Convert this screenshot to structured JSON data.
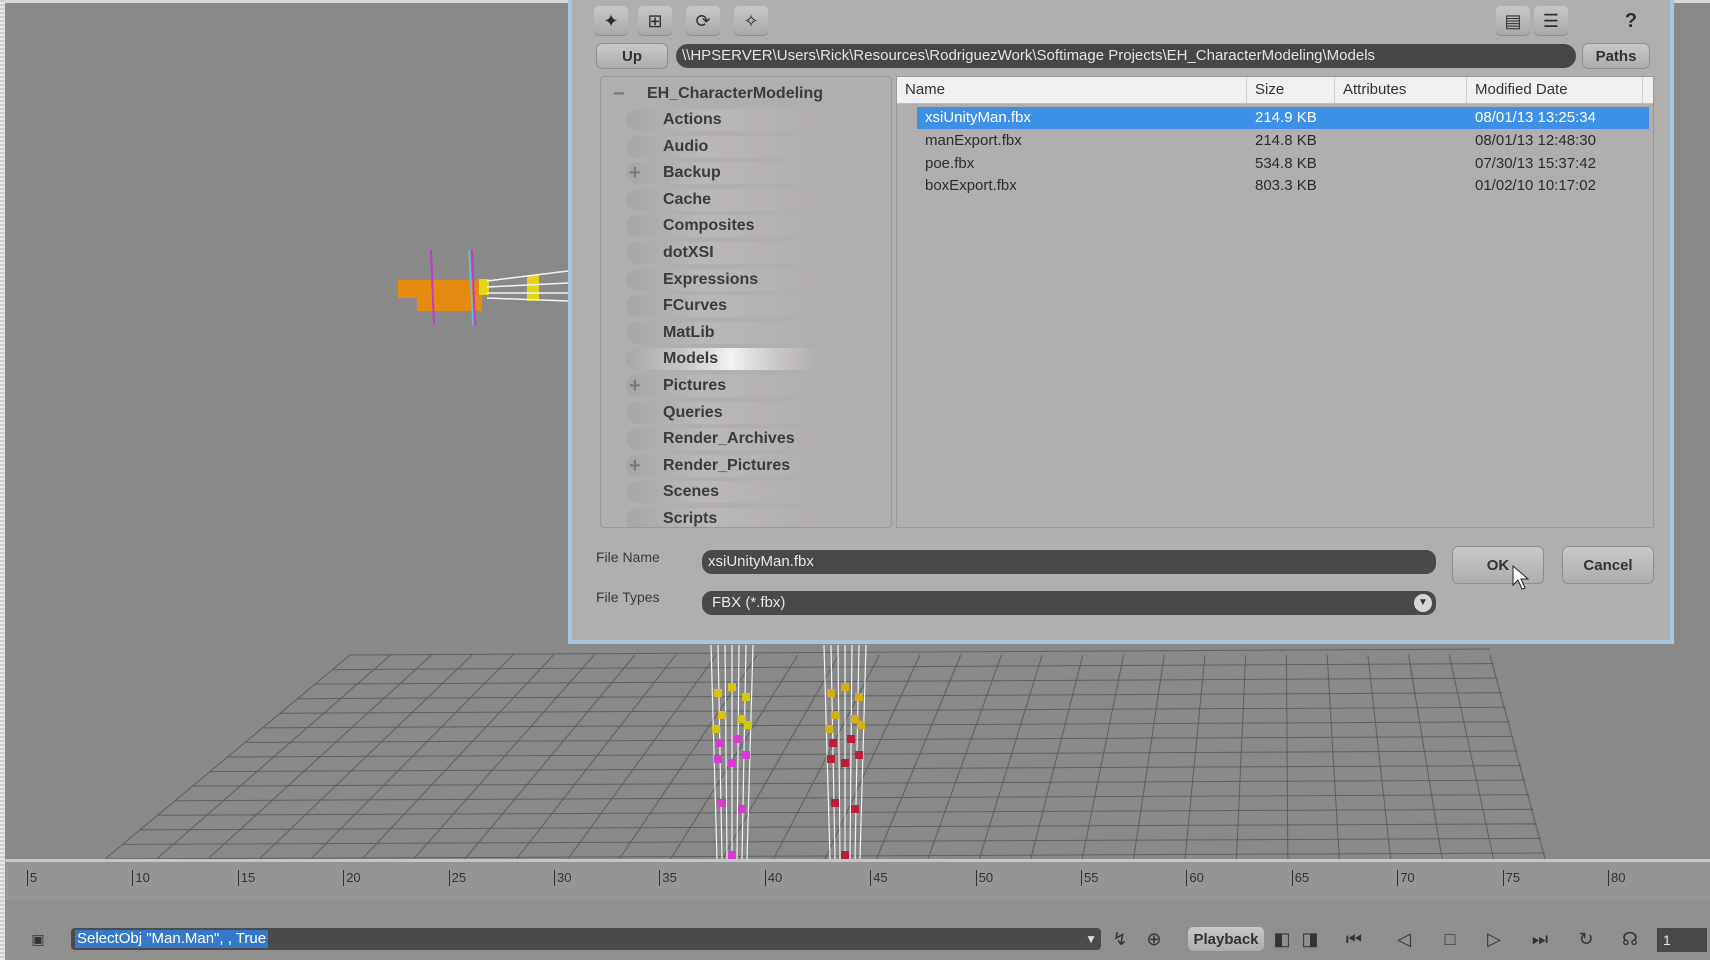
{
  "dialog": {
    "toolbar_icons": [
      "new-folder-icon",
      "network-icon",
      "refresh-icon",
      "open-folder-icon"
    ],
    "right_icons": [
      "clapper-icon",
      "list-view-icon",
      "help-icon"
    ],
    "up_label": "Up",
    "path": "\\\\HPSERVER\\Users\\Rick\\Resources\\RodriguezWork\\Softimage Projects\\EH_CharacterModeling\\Models",
    "paths_label": "Paths",
    "help_glyph": "?",
    "tree": {
      "root": {
        "label": "EH_CharacterModeling",
        "expander": "−"
      },
      "items": [
        {
          "label": "Actions",
          "expander": ""
        },
        {
          "label": "Audio",
          "expander": ""
        },
        {
          "label": "Backup",
          "expander": "+"
        },
        {
          "label": "Cache",
          "expander": ""
        },
        {
          "label": "Composites",
          "expander": ""
        },
        {
          "label": "dotXSI",
          "expander": ""
        },
        {
          "label": "Expressions",
          "expander": ""
        },
        {
          "label": "FCurves",
          "expander": ""
        },
        {
          "label": "MatLib",
          "expander": ""
        },
        {
          "label": "Models",
          "expander": "",
          "selected": true
        },
        {
          "label": "Pictures",
          "expander": "+"
        },
        {
          "label": "Queries",
          "expander": ""
        },
        {
          "label": "Render_Archives",
          "expander": ""
        },
        {
          "label": "Render_Pictures",
          "expander": "+"
        },
        {
          "label": "Scenes",
          "expander": ""
        },
        {
          "label": "Scripts",
          "expander": ""
        }
      ]
    },
    "scroll_up": "˄",
    "scroll_down": "˅",
    "columns": [
      "Name",
      "Size",
      "Attributes",
      "Modified Date"
    ],
    "files": [
      {
        "name": "xsiUnityMan.fbx",
        "size": "214.9 KB",
        "attributes": "",
        "modified": "08/01/13 13:25:34",
        "selected": true
      },
      {
        "name": "manExport.fbx",
        "size": "214.8 KB",
        "attributes": "",
        "modified": "08/01/13 12:48:30"
      },
      {
        "name": "poe.fbx",
        "size": "534.8 KB",
        "attributes": "",
        "modified": "07/30/13 15:37:42"
      },
      {
        "name": "boxExport.fbx",
        "size": "803.3 KB",
        "attributes": "",
        "modified": "01/02/10 10:17:02"
      }
    ],
    "file_name_label": "File Name",
    "file_name_value": "xsiUnityMan.fbx",
    "file_types_label": "File Types",
    "file_types_value": "FBX (*.fbx)",
    "ok_label": "OK",
    "cancel_label": "Cancel"
  },
  "timeline": {
    "ticks": [
      "5",
      "10",
      "15",
      "20",
      "25",
      "30",
      "35",
      "40",
      "45",
      "50",
      "55",
      "60",
      "65",
      "70",
      "75",
      "80"
    ]
  },
  "command_bar": {
    "command": "SelectObj \"Man.Man\", , True",
    "playback_label": "Playback",
    "frame_value": "1"
  },
  "colors": {
    "selection": "#3c91e6",
    "dialog_border": "#a9c4df",
    "viewport_bg": "#898989"
  }
}
